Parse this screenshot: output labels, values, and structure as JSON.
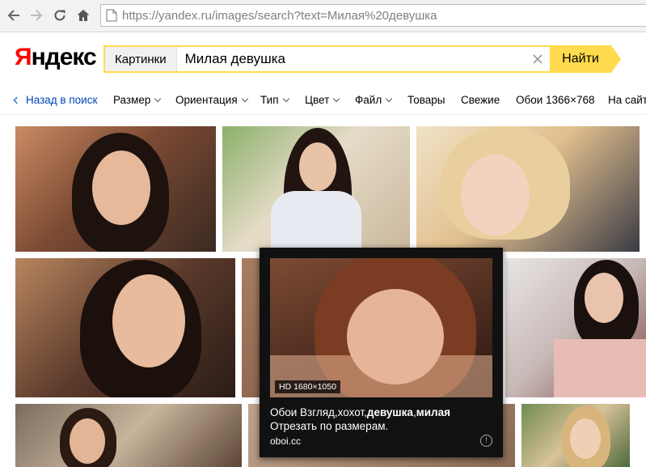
{
  "browser": {
    "url_host": "https://yandex.ru",
    "url_path": "/images/search?text=Милая%20девушка",
    "icons": [
      "back-arrow-icon",
      "forward-arrow-icon",
      "reload-icon",
      "home-icon",
      "page-icon"
    ]
  },
  "header": {
    "logo_first": "Я",
    "logo_rest": "ндекс",
    "search_scope": "Картинки",
    "search_query": "Милая девушка",
    "search_button": "Найти",
    "accent_color": "#ffdb4d"
  },
  "filters": {
    "back": "Назад в поиск",
    "items": [
      "Размер",
      "Ориентация",
      "Тип",
      "Цвет",
      "Файл",
      "Товары",
      "Свежие",
      "Обои 1366×768",
      "На сайте"
    ]
  },
  "popup": {
    "badge": "HD 1680×1050",
    "title_parts": [
      "Обои Взгляд,хохот,",
      "девушка",
      ",",
      "милая"
    ],
    "line2": "Отрезать по размерам.",
    "source": "oboi.cc",
    "info": "!"
  }
}
